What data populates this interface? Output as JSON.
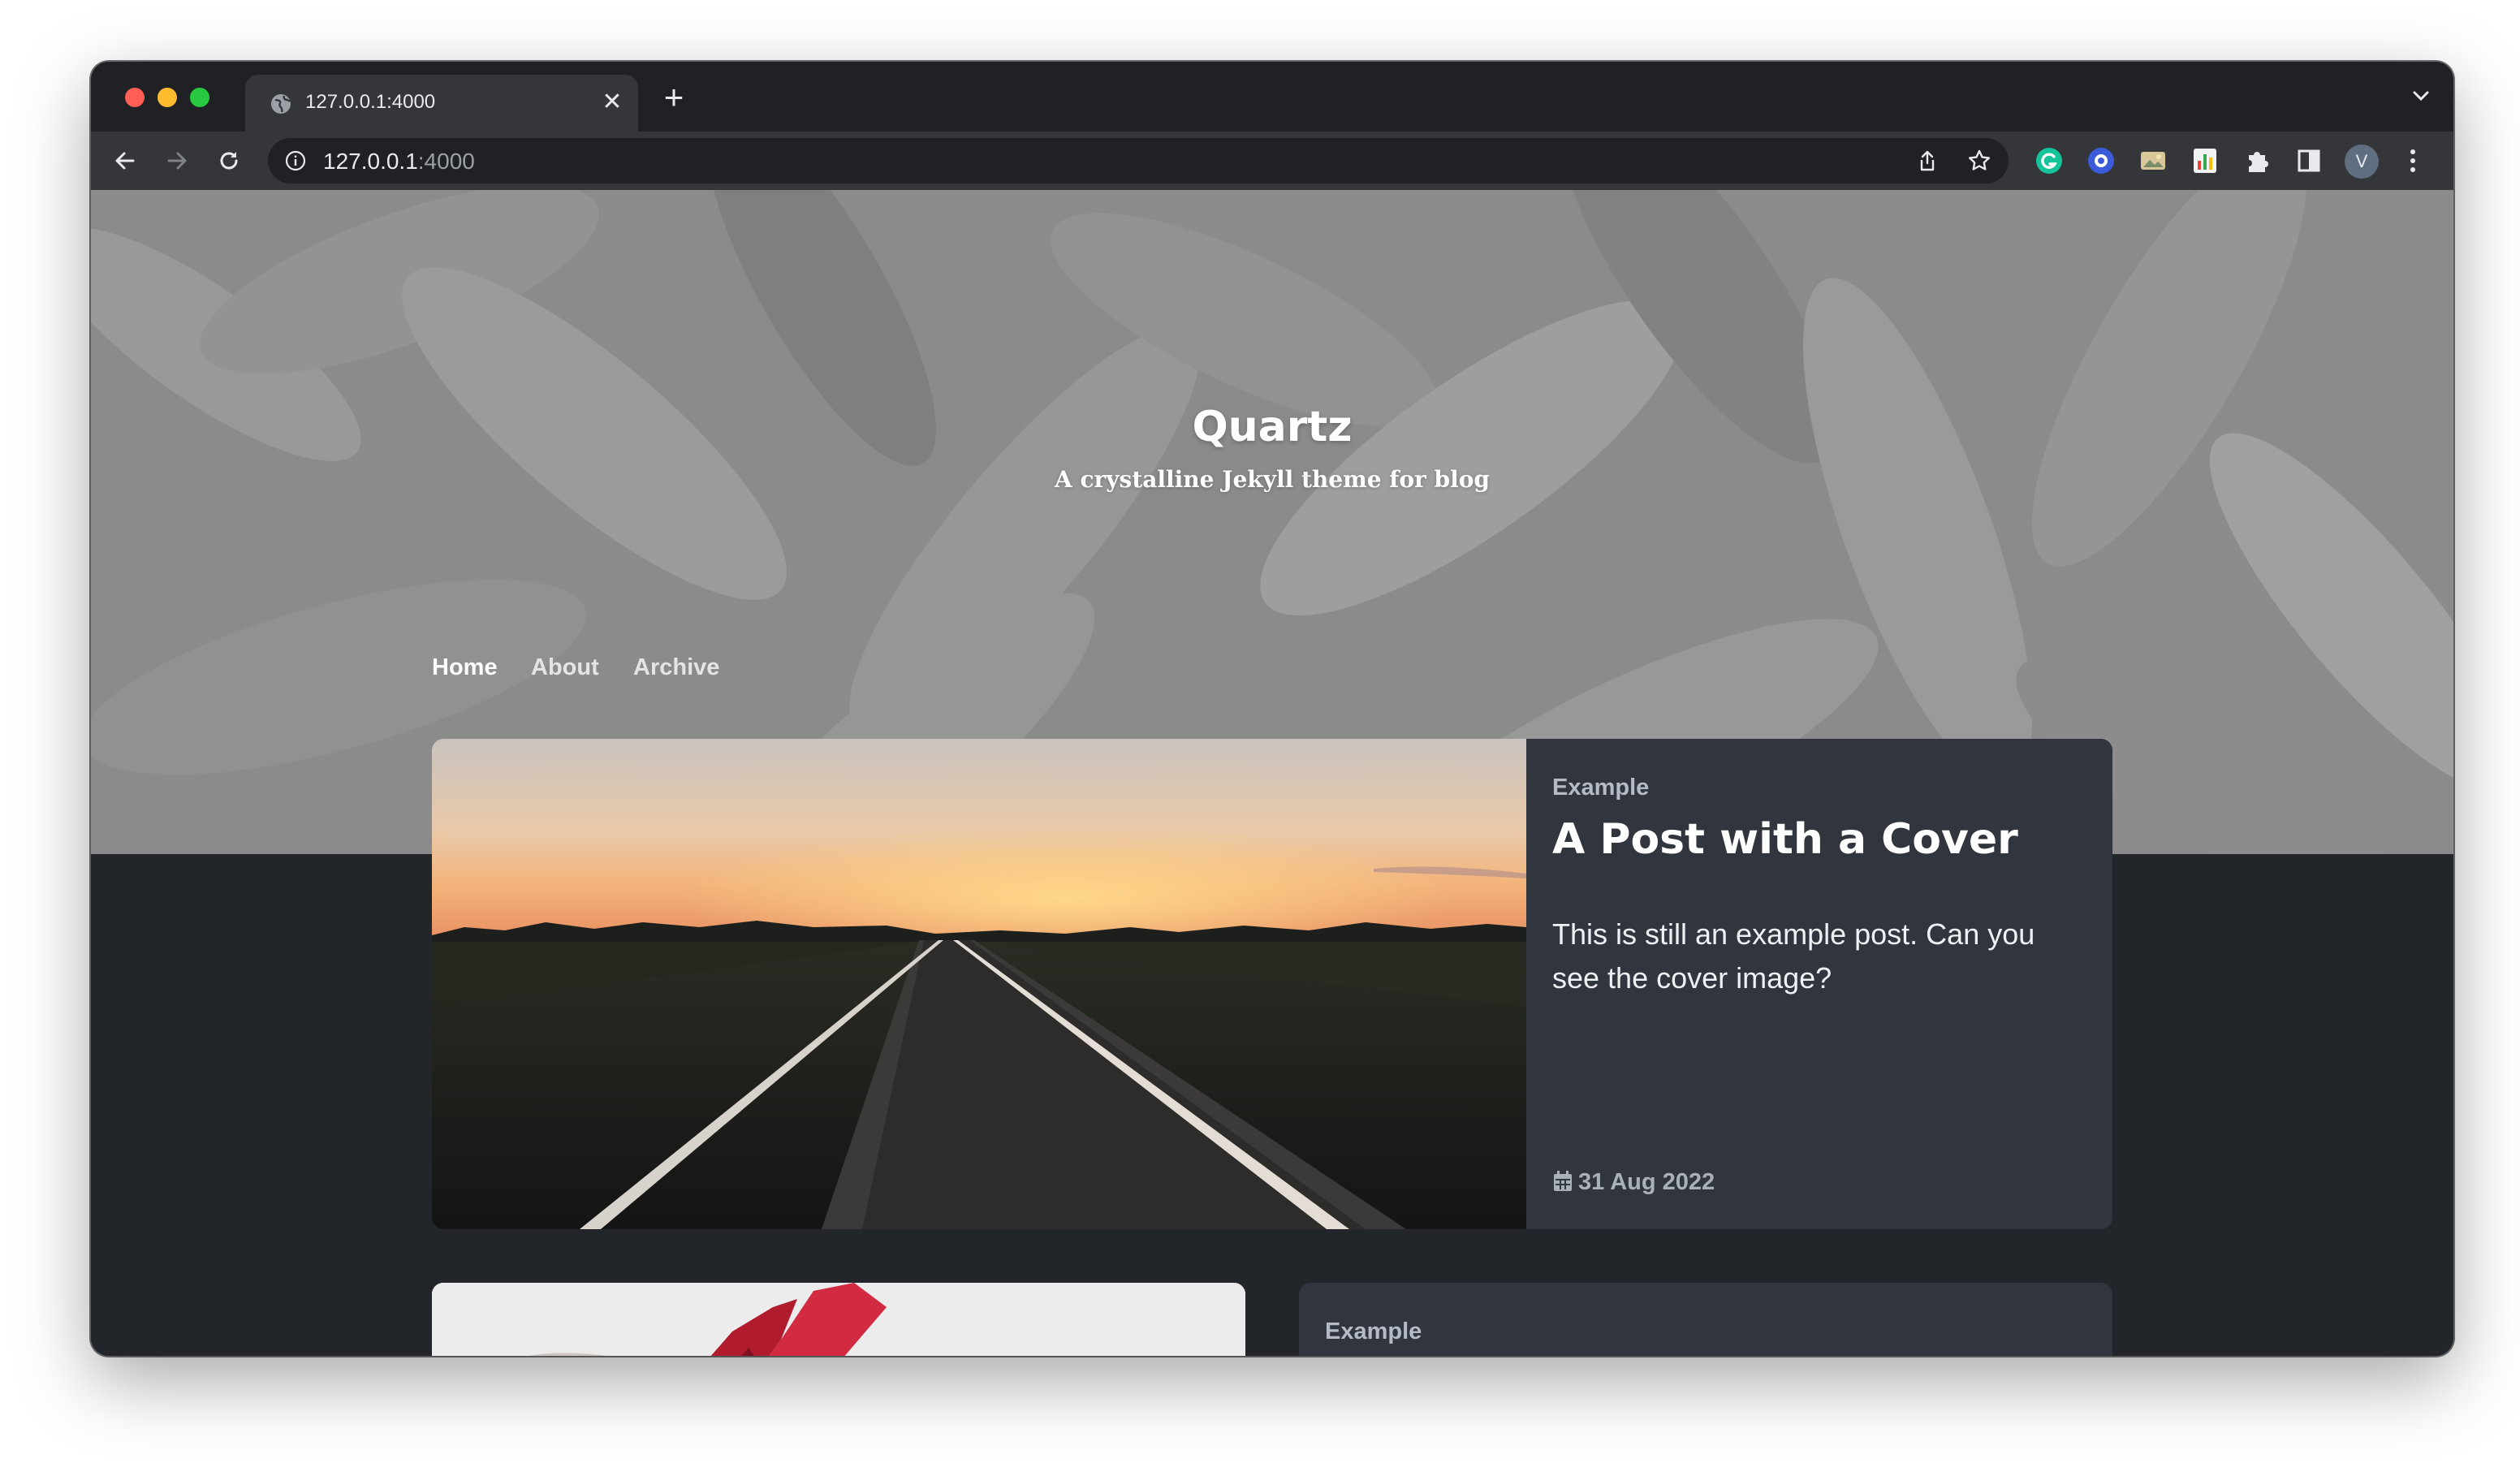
{
  "browser": {
    "tab_title": "127.0.0.1:4000",
    "url_host": "127.0.0.1",
    "url_port": ":4000",
    "profile_initial": "V",
    "icons": [
      "globe-icon",
      "close-icon",
      "plus-icon",
      "chevron-down-icon",
      "back-arrow-icon",
      "forward-arrow-icon",
      "reload-icon",
      "info-icon",
      "share-icon",
      "star-icon",
      "grammarly-icon",
      "extension-icon",
      "puzzle-icon",
      "side-panel-icon",
      "kebab-menu-icon"
    ]
  },
  "site": {
    "title": "Quartz",
    "subtitle": "A crystalline Jekyll theme for blog",
    "nav": [
      {
        "label": "Home",
        "active": true
      },
      {
        "label": "About",
        "active": false
      },
      {
        "label": "Archive",
        "active": false
      }
    ]
  },
  "featured_post": {
    "category": "Example",
    "title": "A Post with a Cover",
    "excerpt": "This is still an example post. Can you see the cover image?",
    "date": "31 Aug 2022",
    "icons": [
      "calendar-icon"
    ]
  },
  "next_posts": [
    {
      "category": "Example"
    }
  ],
  "colors": {
    "page_bg": "#22252a",
    "card_bg": "#31353d",
    "nav_active": "#ffffff",
    "nav_inactive": "#e4e4e4"
  }
}
